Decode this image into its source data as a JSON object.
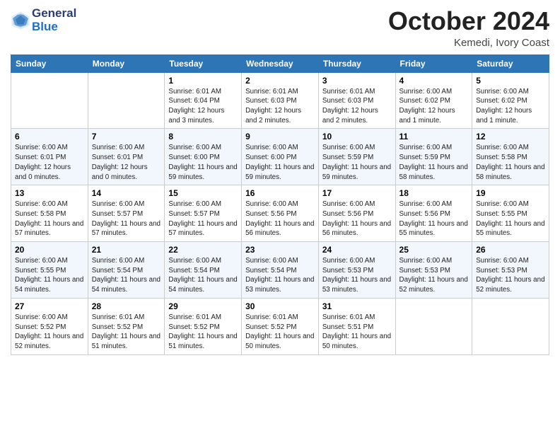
{
  "header": {
    "logo_general": "General",
    "logo_blue": "Blue",
    "month_title": "October 2024",
    "location": "Kemedi, Ivory Coast"
  },
  "weekdays": [
    "Sunday",
    "Monday",
    "Tuesday",
    "Wednesday",
    "Thursday",
    "Friday",
    "Saturday"
  ],
  "weeks": [
    [
      {
        "day": "",
        "info": ""
      },
      {
        "day": "",
        "info": ""
      },
      {
        "day": "1",
        "info": "Sunrise: 6:01 AM\nSunset: 6:04 PM\nDaylight: 12 hours and 3 minutes."
      },
      {
        "day": "2",
        "info": "Sunrise: 6:01 AM\nSunset: 6:03 PM\nDaylight: 12 hours and 2 minutes."
      },
      {
        "day": "3",
        "info": "Sunrise: 6:01 AM\nSunset: 6:03 PM\nDaylight: 12 hours and 2 minutes."
      },
      {
        "day": "4",
        "info": "Sunrise: 6:00 AM\nSunset: 6:02 PM\nDaylight: 12 hours and 1 minute."
      },
      {
        "day": "5",
        "info": "Sunrise: 6:00 AM\nSunset: 6:02 PM\nDaylight: 12 hours and 1 minute."
      }
    ],
    [
      {
        "day": "6",
        "info": "Sunrise: 6:00 AM\nSunset: 6:01 PM\nDaylight: 12 hours and 0 minutes."
      },
      {
        "day": "7",
        "info": "Sunrise: 6:00 AM\nSunset: 6:01 PM\nDaylight: 12 hours and 0 minutes."
      },
      {
        "day": "8",
        "info": "Sunrise: 6:00 AM\nSunset: 6:00 PM\nDaylight: 11 hours and 59 minutes."
      },
      {
        "day": "9",
        "info": "Sunrise: 6:00 AM\nSunset: 6:00 PM\nDaylight: 11 hours and 59 minutes."
      },
      {
        "day": "10",
        "info": "Sunrise: 6:00 AM\nSunset: 5:59 PM\nDaylight: 11 hours and 59 minutes."
      },
      {
        "day": "11",
        "info": "Sunrise: 6:00 AM\nSunset: 5:59 PM\nDaylight: 11 hours and 58 minutes."
      },
      {
        "day": "12",
        "info": "Sunrise: 6:00 AM\nSunset: 5:58 PM\nDaylight: 11 hours and 58 minutes."
      }
    ],
    [
      {
        "day": "13",
        "info": "Sunrise: 6:00 AM\nSunset: 5:58 PM\nDaylight: 11 hours and 57 minutes."
      },
      {
        "day": "14",
        "info": "Sunrise: 6:00 AM\nSunset: 5:57 PM\nDaylight: 11 hours and 57 minutes."
      },
      {
        "day": "15",
        "info": "Sunrise: 6:00 AM\nSunset: 5:57 PM\nDaylight: 11 hours and 57 minutes."
      },
      {
        "day": "16",
        "info": "Sunrise: 6:00 AM\nSunset: 5:56 PM\nDaylight: 11 hours and 56 minutes."
      },
      {
        "day": "17",
        "info": "Sunrise: 6:00 AM\nSunset: 5:56 PM\nDaylight: 11 hours and 56 minutes."
      },
      {
        "day": "18",
        "info": "Sunrise: 6:00 AM\nSunset: 5:56 PM\nDaylight: 11 hours and 55 minutes."
      },
      {
        "day": "19",
        "info": "Sunrise: 6:00 AM\nSunset: 5:55 PM\nDaylight: 11 hours and 55 minutes."
      }
    ],
    [
      {
        "day": "20",
        "info": "Sunrise: 6:00 AM\nSunset: 5:55 PM\nDaylight: 11 hours and 54 minutes."
      },
      {
        "day": "21",
        "info": "Sunrise: 6:00 AM\nSunset: 5:54 PM\nDaylight: 11 hours and 54 minutes."
      },
      {
        "day": "22",
        "info": "Sunrise: 6:00 AM\nSunset: 5:54 PM\nDaylight: 11 hours and 54 minutes."
      },
      {
        "day": "23",
        "info": "Sunrise: 6:00 AM\nSunset: 5:54 PM\nDaylight: 11 hours and 53 minutes."
      },
      {
        "day": "24",
        "info": "Sunrise: 6:00 AM\nSunset: 5:53 PM\nDaylight: 11 hours and 53 minutes."
      },
      {
        "day": "25",
        "info": "Sunrise: 6:00 AM\nSunset: 5:53 PM\nDaylight: 11 hours and 52 minutes."
      },
      {
        "day": "26",
        "info": "Sunrise: 6:00 AM\nSunset: 5:53 PM\nDaylight: 11 hours and 52 minutes."
      }
    ],
    [
      {
        "day": "27",
        "info": "Sunrise: 6:00 AM\nSunset: 5:52 PM\nDaylight: 11 hours and 52 minutes."
      },
      {
        "day": "28",
        "info": "Sunrise: 6:01 AM\nSunset: 5:52 PM\nDaylight: 11 hours and 51 minutes."
      },
      {
        "day": "29",
        "info": "Sunrise: 6:01 AM\nSunset: 5:52 PM\nDaylight: 11 hours and 51 minutes."
      },
      {
        "day": "30",
        "info": "Sunrise: 6:01 AM\nSunset: 5:52 PM\nDaylight: 11 hours and 50 minutes."
      },
      {
        "day": "31",
        "info": "Sunrise: 6:01 AM\nSunset: 5:51 PM\nDaylight: 11 hours and 50 minutes."
      },
      {
        "day": "",
        "info": ""
      },
      {
        "day": "",
        "info": ""
      }
    ]
  ]
}
